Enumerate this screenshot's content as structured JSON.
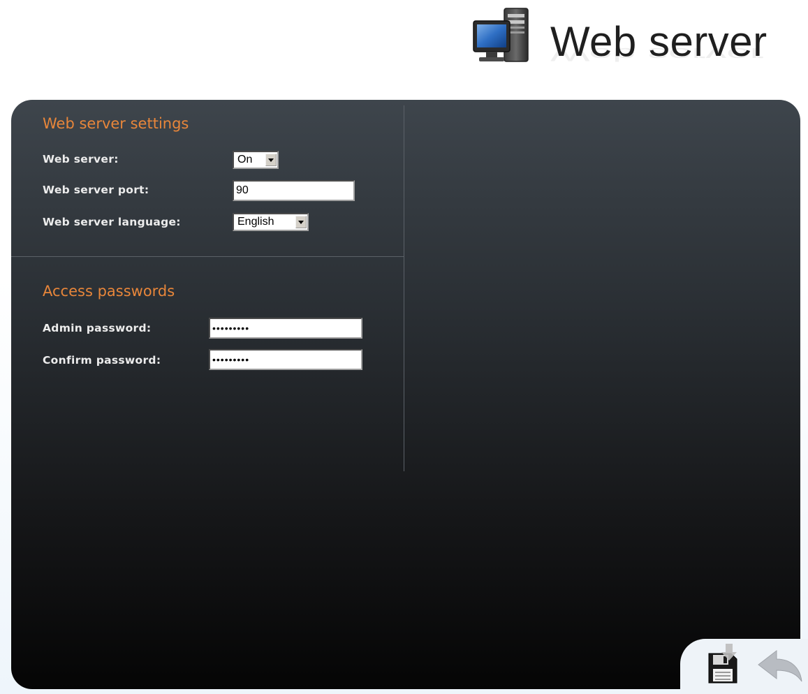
{
  "header": {
    "title": "Web server",
    "icon": "computer-server-icon"
  },
  "settings": {
    "section_title": "Web server settings",
    "web_server": {
      "label": "Web server:",
      "value": "On"
    },
    "port": {
      "label": "Web server port:",
      "value": "90"
    },
    "language": {
      "label": "Web server language:",
      "value": "English"
    }
  },
  "passwords": {
    "section_title": "Access passwords",
    "admin": {
      "label": "Admin password:",
      "value": "•••••••••"
    },
    "confirm": {
      "label": "Confirm password:",
      "value": "•••••••••"
    }
  },
  "actions": {
    "save_icon": "save-icon",
    "back_icon": "back-arrow-icon"
  },
  "colors": {
    "section_title": "#e8863a",
    "panel_top": "#3e454c",
    "panel_bottom": "#050505"
  }
}
